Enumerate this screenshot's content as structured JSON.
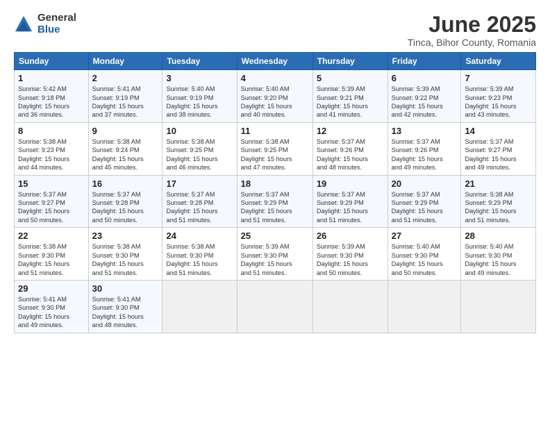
{
  "logo": {
    "general": "General",
    "blue": "Blue"
  },
  "title": "June 2025",
  "subtitle": "Tinca, Bihor County, Romania",
  "weekdays": [
    "Sunday",
    "Monday",
    "Tuesday",
    "Wednesday",
    "Thursday",
    "Friday",
    "Saturday"
  ],
  "weeks": [
    [
      {
        "day": 1,
        "info": "Sunrise: 5:42 AM\nSunset: 9:18 PM\nDaylight: 15 hours\nand 36 minutes."
      },
      {
        "day": 2,
        "info": "Sunrise: 5:41 AM\nSunset: 9:19 PM\nDaylight: 15 hours\nand 37 minutes."
      },
      {
        "day": 3,
        "info": "Sunrise: 5:40 AM\nSunset: 9:19 PM\nDaylight: 15 hours\nand 38 minutes."
      },
      {
        "day": 4,
        "info": "Sunrise: 5:40 AM\nSunset: 9:20 PM\nDaylight: 15 hours\nand 40 minutes."
      },
      {
        "day": 5,
        "info": "Sunrise: 5:39 AM\nSunset: 9:21 PM\nDaylight: 15 hours\nand 41 minutes."
      },
      {
        "day": 6,
        "info": "Sunrise: 5:39 AM\nSunset: 9:22 PM\nDaylight: 15 hours\nand 42 minutes."
      },
      {
        "day": 7,
        "info": "Sunrise: 5:39 AM\nSunset: 9:23 PM\nDaylight: 15 hours\nand 43 minutes."
      }
    ],
    [
      {
        "day": 8,
        "info": "Sunrise: 5:38 AM\nSunset: 9:23 PM\nDaylight: 15 hours\nand 44 minutes."
      },
      {
        "day": 9,
        "info": "Sunrise: 5:38 AM\nSunset: 9:24 PM\nDaylight: 15 hours\nand 45 minutes."
      },
      {
        "day": 10,
        "info": "Sunrise: 5:38 AM\nSunset: 9:25 PM\nDaylight: 15 hours\nand 46 minutes."
      },
      {
        "day": 11,
        "info": "Sunrise: 5:38 AM\nSunset: 9:25 PM\nDaylight: 15 hours\nand 47 minutes."
      },
      {
        "day": 12,
        "info": "Sunrise: 5:37 AM\nSunset: 9:26 PM\nDaylight: 15 hours\nand 48 minutes."
      },
      {
        "day": 13,
        "info": "Sunrise: 5:37 AM\nSunset: 9:26 PM\nDaylight: 15 hours\nand 49 minutes."
      },
      {
        "day": 14,
        "info": "Sunrise: 5:37 AM\nSunset: 9:27 PM\nDaylight: 15 hours\nand 49 minutes."
      }
    ],
    [
      {
        "day": 15,
        "info": "Sunrise: 5:37 AM\nSunset: 9:27 PM\nDaylight: 15 hours\nand 50 minutes."
      },
      {
        "day": 16,
        "info": "Sunrise: 5:37 AM\nSunset: 9:28 PM\nDaylight: 15 hours\nand 50 minutes."
      },
      {
        "day": 17,
        "info": "Sunrise: 5:37 AM\nSunset: 9:28 PM\nDaylight: 15 hours\nand 51 minutes."
      },
      {
        "day": 18,
        "info": "Sunrise: 5:37 AM\nSunset: 9:29 PM\nDaylight: 15 hours\nand 51 minutes."
      },
      {
        "day": 19,
        "info": "Sunrise: 5:37 AM\nSunset: 9:29 PM\nDaylight: 15 hours\nand 51 minutes."
      },
      {
        "day": 20,
        "info": "Sunrise: 5:37 AM\nSunset: 9:29 PM\nDaylight: 15 hours\nand 51 minutes."
      },
      {
        "day": 21,
        "info": "Sunrise: 5:38 AM\nSunset: 9:29 PM\nDaylight: 15 hours\nand 51 minutes."
      }
    ],
    [
      {
        "day": 22,
        "info": "Sunrise: 5:38 AM\nSunset: 9:30 PM\nDaylight: 15 hours\nand 51 minutes."
      },
      {
        "day": 23,
        "info": "Sunrise: 5:38 AM\nSunset: 9:30 PM\nDaylight: 15 hours\nand 51 minutes."
      },
      {
        "day": 24,
        "info": "Sunrise: 5:38 AM\nSunset: 9:30 PM\nDaylight: 15 hours\nand 51 minutes."
      },
      {
        "day": 25,
        "info": "Sunrise: 5:39 AM\nSunset: 9:30 PM\nDaylight: 15 hours\nand 51 minutes."
      },
      {
        "day": 26,
        "info": "Sunrise: 5:39 AM\nSunset: 9:30 PM\nDaylight: 15 hours\nand 50 minutes."
      },
      {
        "day": 27,
        "info": "Sunrise: 5:40 AM\nSunset: 9:30 PM\nDaylight: 15 hours\nand 50 minutes."
      },
      {
        "day": 28,
        "info": "Sunrise: 5:40 AM\nSunset: 9:30 PM\nDaylight: 15 hours\nand 49 minutes."
      }
    ],
    [
      {
        "day": 29,
        "info": "Sunrise: 5:41 AM\nSunset: 9:30 PM\nDaylight: 15 hours\nand 49 minutes."
      },
      {
        "day": 30,
        "info": "Sunrise: 5:41 AM\nSunset: 9:30 PM\nDaylight: 15 hours\nand 48 minutes."
      },
      null,
      null,
      null,
      null,
      null
    ]
  ]
}
